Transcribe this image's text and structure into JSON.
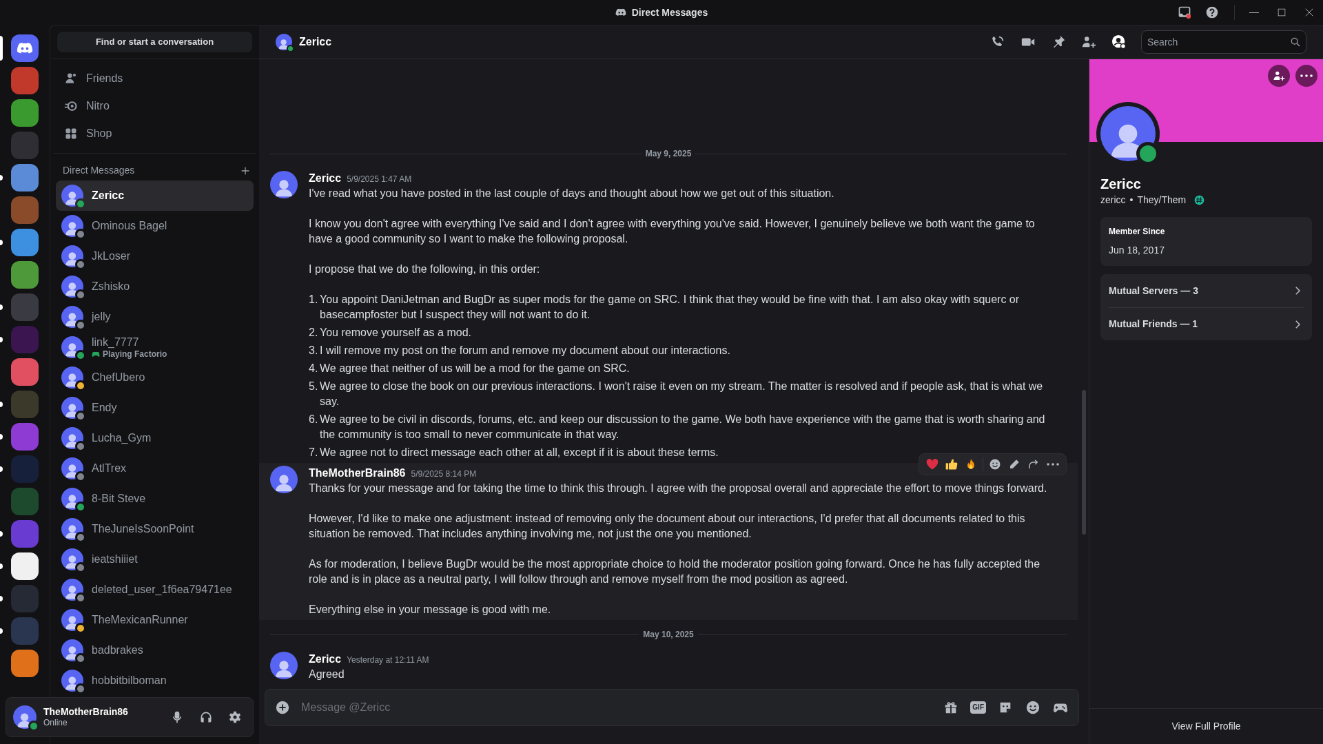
{
  "window": {
    "title": "Direct Messages"
  },
  "servers": [
    {
      "color": "#c0392b",
      "unread": false
    },
    {
      "color": "#3b9a2f",
      "unread": false
    },
    {
      "color": "#2e2e34",
      "unread": false
    },
    {
      "color": "#5b8bd6",
      "unread": true
    },
    {
      "color": "#8a4b2a",
      "unread": false
    },
    {
      "color": "#3d8fe0",
      "unread": true
    },
    {
      "color": "#4e9a3a",
      "unread": false
    },
    {
      "color": "#3a3a42",
      "unread": true
    },
    {
      "color": "#3a1550",
      "unread": true
    },
    {
      "color": "#e05060",
      "unread": false
    },
    {
      "color": "#3b3a2a",
      "unread": true
    },
    {
      "color": "#8e3bd4",
      "unread": true
    },
    {
      "color": "#17203a",
      "unread": true
    },
    {
      "color": "#1d4a2c",
      "unread": false
    },
    {
      "color": "#6a3bd0",
      "unread": true
    },
    {
      "color": "#f0f0f0",
      "unread": true
    },
    {
      "color": "#262a35",
      "unread": true
    },
    {
      "color": "#2a3550",
      "unread": true
    },
    {
      "color": "#e0701a",
      "unread": false
    }
  ],
  "sidebar": {
    "search": {
      "label": "Find or start a conversation"
    },
    "nav": [
      {
        "kind": "friends",
        "label": "Friends"
      },
      {
        "kind": "nitro",
        "label": "Nitro"
      },
      {
        "kind": "shop",
        "label": "Shop"
      }
    ],
    "dm_heading": "Direct Messages",
    "dms": [
      {
        "name": "Zericc",
        "color": "#23a55a",
        "selected": true
      },
      {
        "name": "Ominous Bagel",
        "color": "#80848e",
        "selected": false
      },
      {
        "name": "JkLoser",
        "color": "#80848e",
        "selected": false
      },
      {
        "name": "Zshisko",
        "color": "#80848e",
        "selected": false
      },
      {
        "name": "jelly",
        "color": "#80848e",
        "selected": false
      },
      {
        "name": "link_7777",
        "color": "#23a55a",
        "selected": false,
        "activity": "Playing Factorio"
      },
      {
        "name": "ChefUbero",
        "color": "#f0b232",
        "selected": false
      },
      {
        "name": "Endy",
        "color": "#80848e",
        "selected": false
      },
      {
        "name": "Lucha_Gym",
        "color": "#80848e",
        "selected": false
      },
      {
        "name": "AtlTrex",
        "color": "#80848e",
        "selected": false
      },
      {
        "name": "8-Bit Steve",
        "color": "#23a55a",
        "selected": false
      },
      {
        "name": "TheJuneIsSoonPoint",
        "color": "#80848e",
        "selected": false
      },
      {
        "name": "ieatshiiiet",
        "color": "#80848e",
        "selected": false
      },
      {
        "name": "deleted_user_1f6ea79471ee",
        "color": "#80848e",
        "selected": false
      },
      {
        "name": "TheMexicanRunner",
        "color": "#f0b232",
        "selected": false
      },
      {
        "name": "badbrakes",
        "color": "#80848e",
        "selected": false
      },
      {
        "name": "hobbitbilboman",
        "color": "#80848e",
        "selected": false
      }
    ],
    "user_panel": {
      "name": "TheMotherBrain86",
      "status_text": "Online",
      "color": "#23a55a"
    }
  },
  "chat": {
    "header": {
      "name": "Zericc",
      "color": "#23a55a"
    },
    "search_placeholder": "Search",
    "timeline": [
      {
        "kind": "date",
        "text": "May 9, 2025"
      },
      {
        "kind": "message",
        "author": "Zericc",
        "time": "5/9/2025 1:47 AM",
        "hovered": false,
        "blocks": [
          {
            "kind": "text",
            "text": "I've read what you have posted in the last couple of days and thought about how we get out of this situation."
          },
          {
            "kind": "text",
            "text": "I know you don't agree with everything I've said and I don't agree with everything you've said. However, I genuinely believe we both want the game to have a good community so I want to make the following proposal."
          },
          {
            "kind": "text",
            "text": "I propose that we do the following, in this order:"
          },
          {
            "kind": "list",
            "items": [
              {
                "number": "1.",
                "text": "You appoint DaniJetman and BugDr as super mods for the game on SRC. I think that they would be fine with that. I am also okay with squerc or basecampfoster but I suspect they will not want to do it."
              },
              {
                "number": "2.",
                "text": "You remove yourself as a mod."
              },
              {
                "number": "3.",
                "text": "I will remove my post on the forum and remove my document about our interactions."
              },
              {
                "number": "4.",
                "text": "We agree that neither of us will be a mod for the game on SRC."
              },
              {
                "number": "5.",
                "text": "We agree to close the book on our previous interactions. I won't raise it even on my stream. The matter is resolved and if people ask, that is what we say."
              },
              {
                "number": "6.",
                "text": "We agree to be civil in discords, forums, etc. and keep our discussion to the game. We both have experience with the game that is worth sharing and the community is too small to never communicate in that way."
              },
              {
                "number": "7.",
                "text": "We agree not to direct message each other at all, except if it is about these terms."
              }
            ]
          }
        ]
      },
      {
        "kind": "message",
        "author": "TheMotherBrain86",
        "time": "5/9/2025 8:14 PM",
        "hovered": true,
        "blocks": [
          {
            "kind": "text",
            "text": "Thanks for your message and for taking the time to think this through. I agree with the proposal overall and appreciate the effort to move things forward."
          },
          {
            "kind": "text",
            "text": "However, I'd like to make one adjustment: instead of removing only the document about our interactions, I'd prefer that all documents related to this situation be removed. That includes anything involving me, not just the one you mentioned."
          },
          {
            "kind": "text",
            "text": "As for moderation, I believe BugDr would be the most appropriate choice to hold the moderator position going forward. Once he has fully accepted the role and is in place as a neutral party, I will follow through and remove myself from the mod position as agreed."
          },
          {
            "kind": "text",
            "text": "Everything else in your message is good with me."
          }
        ]
      },
      {
        "kind": "date",
        "text": "May 10, 2025"
      },
      {
        "kind": "message",
        "author": "Zericc",
        "time": "Yesterday at 12:11 AM",
        "hovered": false,
        "blocks": [
          {
            "kind": "text",
            "text": "Agreed"
          }
        ]
      }
    ],
    "composer": {
      "placeholder": "Message @Zericc",
      "gif_label": "GIF"
    }
  },
  "profile": {
    "display_name": "Zericc",
    "username": "zericc",
    "separator": "•",
    "pronouns": "They/Them",
    "color": "#23a55a",
    "member_since_label": "Member Since",
    "member_since": "Jun 18, 2017",
    "mutuals": [
      "Mutual Servers — 3",
      "Mutual Friends — 1"
    ],
    "footer": "View Full Profile"
  }
}
